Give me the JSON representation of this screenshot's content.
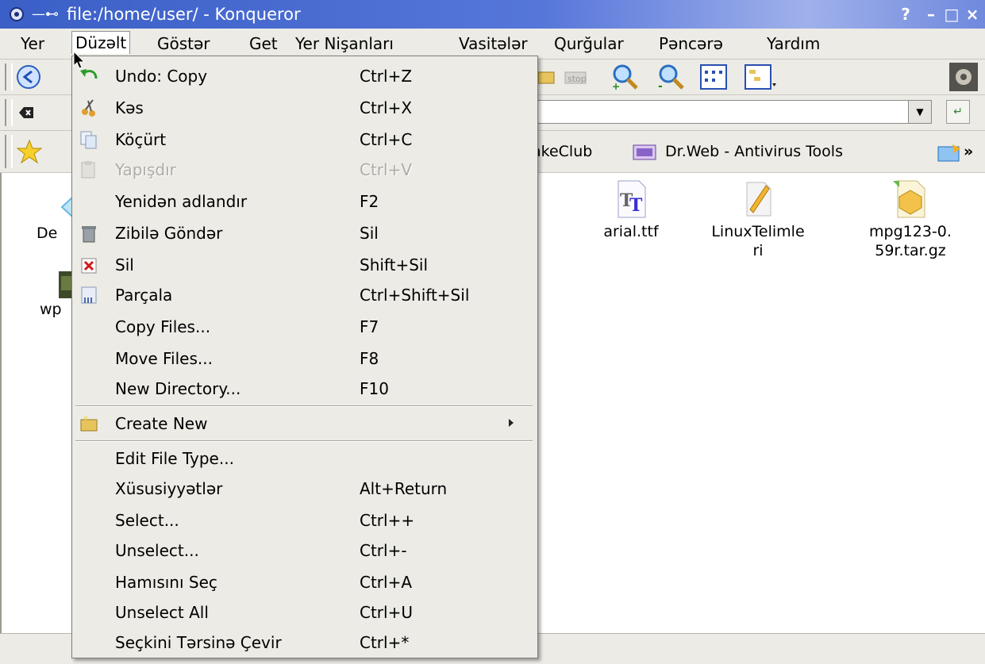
{
  "window": {
    "title": "file:/home/user/ - Konqueror",
    "help_btn": "?",
    "minimize_btn": "–",
    "maximize_btn": "□",
    "close_btn": "×"
  },
  "menubar": {
    "items": [
      "Yer",
      "Düzəlt",
      "Göstər",
      "Get",
      "Yer Nişanları",
      "Vasitələr",
      "Qurğular",
      "Pəncərə",
      "Yardım"
    ]
  },
  "bookmarks": {
    "partial_item": "akeClub",
    "drweb": "Dr.Web - Antivirus Tools",
    "more": "»"
  },
  "files": [
    {
      "name": "De",
      "icon": "desktop-folder-icon"
    },
    {
      "name": "wp",
      "icon": "image-file-icon"
    },
    {
      "name": "arial.ttf",
      "icon": "truetype-font-icon"
    },
    {
      "name": "LinuxTelimle\nri",
      "icon": "text-document-icon"
    },
    {
      "name": "mpg123-0.\n59r.tar.gz",
      "icon": "archive-package-icon"
    }
  ],
  "edit_menu": {
    "items": [
      {
        "label": "Undo: Copy",
        "shortcut": "Ctrl+Z",
        "icon": "undo-icon"
      },
      {
        "label": "Kəs",
        "shortcut": "Ctrl+X",
        "icon": "cut-icon"
      },
      {
        "label": "Köçürt",
        "shortcut": "Ctrl+C",
        "icon": "copy-icon"
      },
      {
        "label": "Yapışdır",
        "shortcut": "Ctrl+V",
        "icon": "paste-icon",
        "disabled": true
      },
      {
        "label": "Yenidən adlandır",
        "shortcut": "F2"
      },
      {
        "label": "Zibilə Göndər",
        "shortcut": "Sil",
        "icon": "trash-icon"
      },
      {
        "label": "Sil",
        "shortcut": "Shift+Sil",
        "icon": "delete-icon"
      },
      {
        "label": "Parçala",
        "shortcut": "Ctrl+Shift+Sil",
        "icon": "shred-icon"
      },
      {
        "label": "Copy Files...",
        "shortcut": "F7"
      },
      {
        "label": "Move Files...",
        "shortcut": "F8"
      },
      {
        "label": "New Directory...",
        "shortcut": "F10"
      },
      {
        "label": "Create New",
        "shortcut": "",
        "icon": "new-folder-icon",
        "submenu": true
      },
      {
        "label": "Edit File Type...",
        "shortcut": ""
      },
      {
        "label": "Xüsusiyyətlər",
        "shortcut": "Alt+Return"
      },
      {
        "label": "Select...",
        "shortcut": "Ctrl++"
      },
      {
        "label": "Unselect...",
        "shortcut": "Ctrl+-"
      },
      {
        "label": "Hamısını Seç",
        "shortcut": "Ctrl+A"
      },
      {
        "label": "Unselect All",
        "shortcut": "Ctrl+U"
      },
      {
        "label": "Seçkini Tərsinə Çevir",
        "shortcut": "Ctrl+*"
      }
    ]
  },
  "colors": {
    "titlebar": "#3a5fc6",
    "menu_bg": "#ecebe6",
    "disabled_text": "#aeaca5"
  }
}
